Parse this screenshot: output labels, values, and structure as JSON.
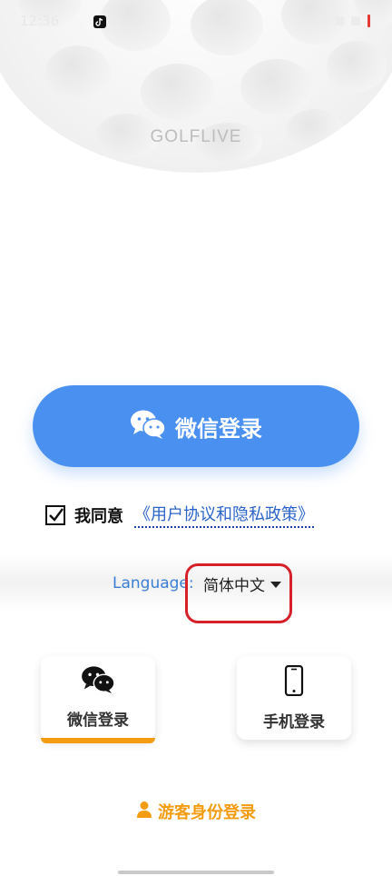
{
  "status_bar": {
    "time": "12:36",
    "icons": [
      "tiktok-icon",
      "wifi-icon",
      "signal-icon",
      "battery-icon"
    ],
    "battery_color": "#e53935"
  },
  "header": {
    "app_name": "GOLFLIVE"
  },
  "main_login": {
    "label": "微信登录",
    "icon": "wechat-icon",
    "color": "#4a90f0"
  },
  "agreement": {
    "checked": true,
    "prefix": "我同意",
    "link_text": "《用户协议和隐私政策》",
    "link_color": "#2b64c8"
  },
  "language": {
    "label": "Language:",
    "selected": "简体中文",
    "label_color": "#3a7fd5"
  },
  "login_options": [
    {
      "label": "微信登录",
      "icon": "wechat-icon",
      "active": true
    },
    {
      "label": "手机登录",
      "icon": "phone-icon",
      "active": false
    }
  ],
  "guest_login": {
    "label": "游客身份登录",
    "icon": "person-icon",
    "color": "#f39c12"
  }
}
